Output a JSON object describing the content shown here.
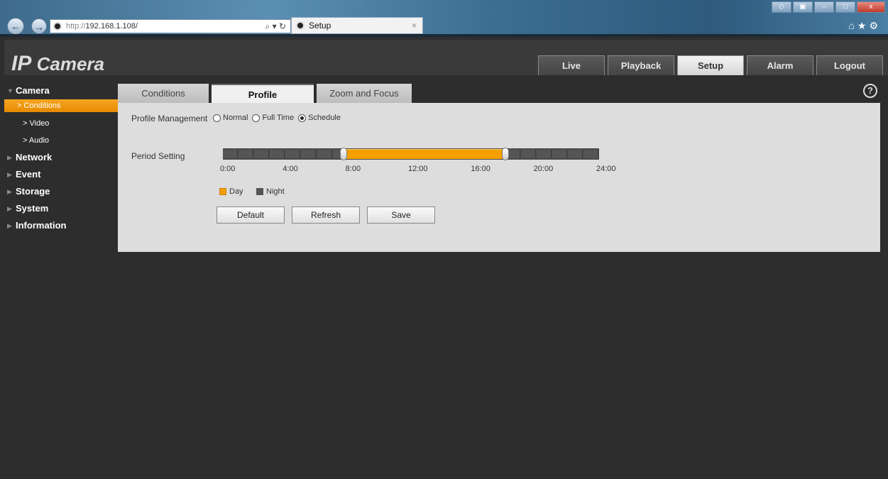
{
  "browser": {
    "url_prefix": "http://",
    "url_host": "192.168.1.108/",
    "tab_title": "Setup",
    "tab_close": "×",
    "back_glyph": "←",
    "forward_glyph": "→",
    "addr_tools": "⌕ ▾ ↻"
  },
  "app": {
    "logo_ip": "IP",
    "logo_rest": " Camera"
  },
  "main_tabs": [
    {
      "label": "Live"
    },
    {
      "label": "Playback"
    },
    {
      "label": "Setup",
      "active": true
    },
    {
      "label": "Alarm"
    },
    {
      "label": "Logout"
    }
  ],
  "sidebar": {
    "camera": "Camera",
    "conditions": "Conditions",
    "video": "Video",
    "audio": "Audio",
    "network": "Network",
    "event": "Event",
    "storage": "Storage",
    "system": "System",
    "information": "Information",
    "item_prefix": "> "
  },
  "sub_tabs": {
    "conditions": "Conditions",
    "profile_management": "Profile Management",
    "zoom_focus": "Zoom and Focus"
  },
  "help": "?",
  "form": {
    "profile_label": "Profile Management",
    "options": {
      "normal": "Normal",
      "full_time": "Full Time",
      "schedule": "Schedule"
    },
    "selected": "Schedule",
    "period_label": "Period Setting",
    "ticks": [
      "0:00",
      "4:00",
      "8:00",
      "12:00",
      "16:00",
      "20:00",
      "24:00"
    ],
    "day_start_hour": 7.7,
    "day_end_hour": 18.0,
    "legend_day": "Day",
    "legend_night": "Night"
  },
  "colors": {
    "day": "#f5a000",
    "night": "#555555",
    "accent": "#f6a623"
  },
  "buttons": {
    "default": "Default",
    "refresh": "Refresh",
    "save": "Save"
  }
}
